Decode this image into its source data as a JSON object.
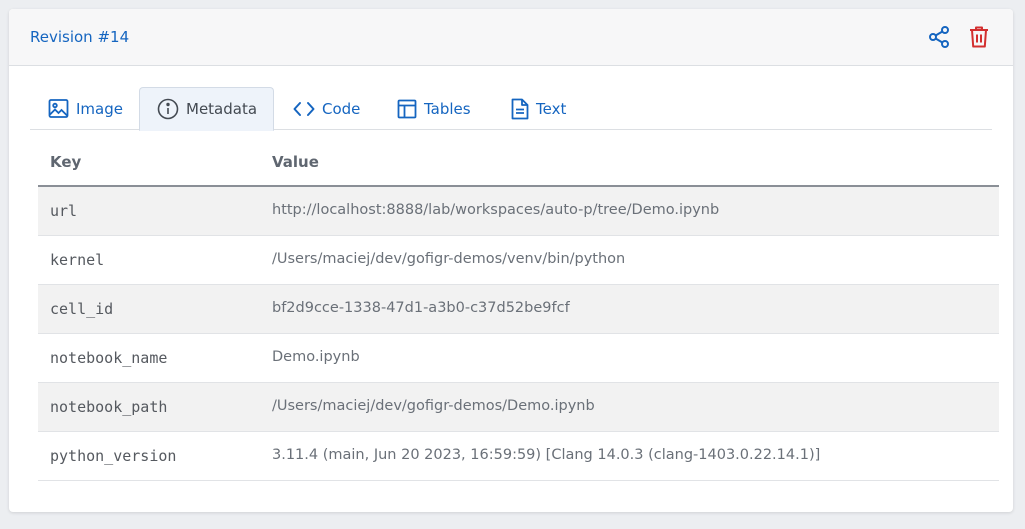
{
  "header": {
    "title": "Revision #14"
  },
  "icons": {
    "share": "share-icon",
    "delete": "trash-icon"
  },
  "colors": {
    "accent": "#1565c0",
    "danger": "#d32f2f"
  },
  "tabs": [
    {
      "label": "Image",
      "icon": "image-icon",
      "active": false
    },
    {
      "label": "Metadata",
      "icon": "info-icon",
      "active": true
    },
    {
      "label": "Code",
      "icon": "code-icon",
      "active": false
    },
    {
      "label": "Tables",
      "icon": "table-icon",
      "active": false
    },
    {
      "label": "Text",
      "icon": "document-icon",
      "active": false
    }
  ],
  "table": {
    "columns": [
      "Key",
      "Value"
    ],
    "rows": [
      {
        "key": "url",
        "value": "http://localhost:8888/lab/workspaces/auto-p/tree/Demo.ipynb"
      },
      {
        "key": "kernel",
        "value": "/Users/maciej/dev/gofigr-demos/venv/bin/python"
      },
      {
        "key": "cell_id",
        "value": "bf2d9cce-1338-47d1-a3b0-c37d52be9fcf"
      },
      {
        "key": "notebook_name",
        "value": "Demo.ipynb"
      },
      {
        "key": "notebook_path",
        "value": "/Users/maciej/dev/gofigr-demos/Demo.ipynb"
      },
      {
        "key": "python_version",
        "value": "3.11.4 (main, Jun 20 2023, 16:59:59) [Clang 14.0.3 (clang-1403.0.22.14.1)]"
      }
    ]
  }
}
